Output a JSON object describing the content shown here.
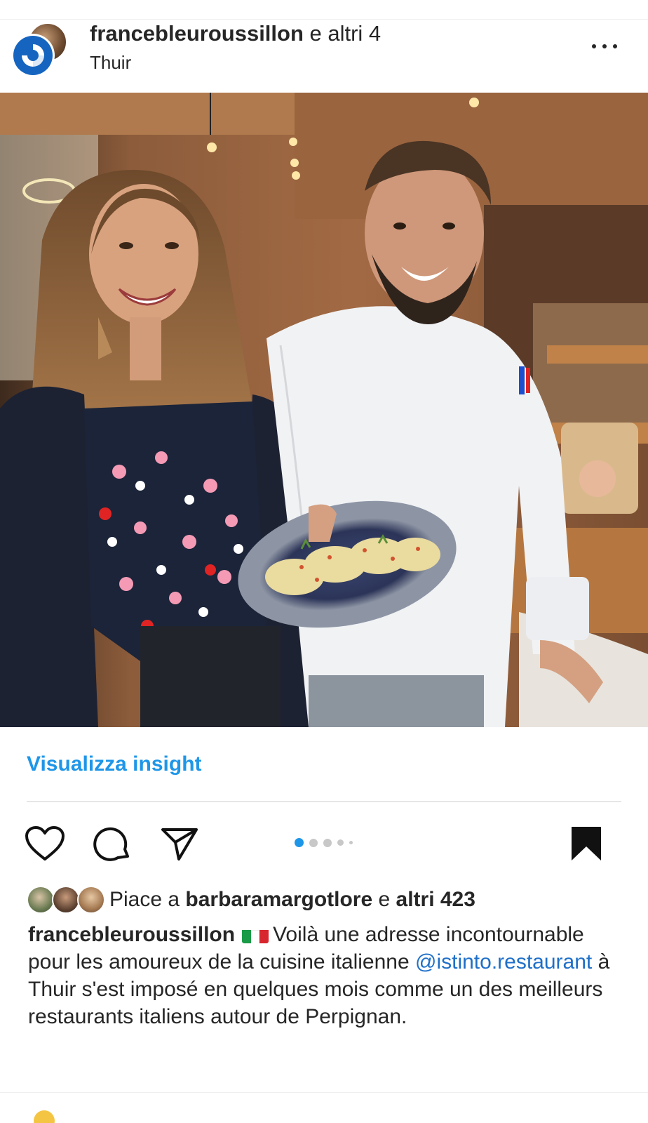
{
  "header": {
    "username": "francebleuroussillon",
    "coauthors_text": " e altri 4",
    "location": "Thuir",
    "more_icon": "more-horizontal-icon"
  },
  "photo": {
    "icon": "post-photo"
  },
  "insight": {
    "label": "Visualizza insight"
  },
  "actions": {
    "like_icon": "heart-icon",
    "comment_icon": "comment-icon",
    "share_icon": "send-icon",
    "save_icon": "bookmark-icon",
    "carousel_total_visible": 5,
    "carousel_active_index": 0,
    "active_dot_color": "#1e96e8"
  },
  "likes": {
    "prefix": "Piace a ",
    "user": "barbaramargotlore",
    "middle": " e ",
    "others": "altri 423"
  },
  "caption": {
    "username": "francebleuroussillon",
    "text_1": "Voilà une adresse incontournable pour les amoureux de la cuisine italienne ",
    "mention": "@istinto.restaurant",
    "text_2": " à Thuir s'est imposé en quelques mois comme un des meilleurs restaurants italiens autour de Perpignan."
  },
  "colors": {
    "accent": "#1e96e8",
    "brand_avatar": "#1565c0"
  }
}
